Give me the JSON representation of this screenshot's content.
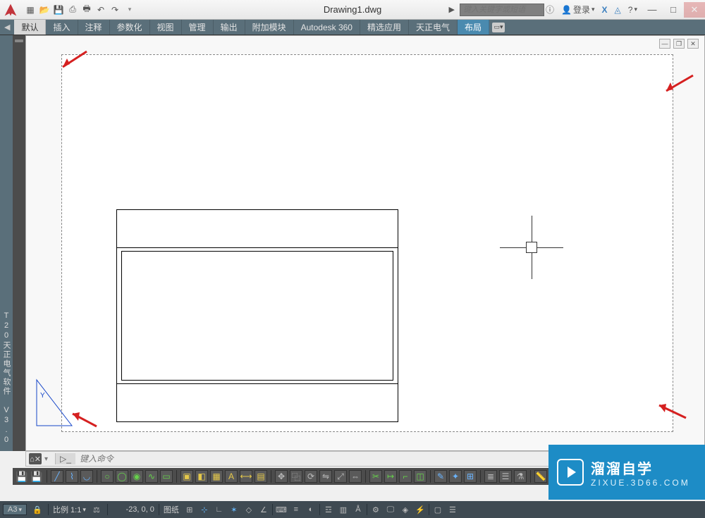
{
  "title": {
    "filename": "Drawing1.dwg"
  },
  "search": {
    "placeholder": "键入关键字或短语"
  },
  "titlebar_right": {
    "login": "登录",
    "help_glyph": "?"
  },
  "ribbon": {
    "tabs": [
      "默认",
      "插入",
      "注释",
      "参数化",
      "视图",
      "管理",
      "输出",
      "附加模块",
      "Autodesk 360",
      "精选应用",
      "天正电气",
      "布局"
    ],
    "active_index": 0,
    "highlight_index": 11
  },
  "sidebar": {
    "label": "T20天正电气软件 V3.0"
  },
  "canvas": {
    "sub_controls": [
      "—",
      "❐",
      "✕"
    ]
  },
  "cmdline": {
    "placeholder": "键入命令"
  },
  "status": {
    "sheet": "A3",
    "scale_label": "比例 1:1",
    "coords": "-23, 0, 0",
    "paper_label": "图纸"
  },
  "watermark": {
    "line1": "溜溜自学",
    "line2": "ZIXUE.3D66.COM"
  }
}
